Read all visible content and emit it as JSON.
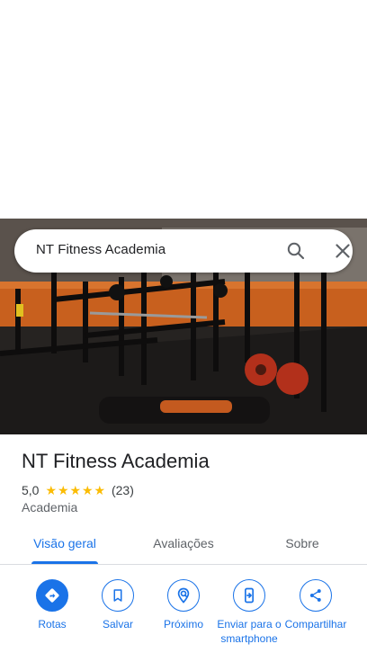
{
  "search": {
    "query": "NT Fitness Academia",
    "search_icon": "search-icon",
    "clear_icon": "close-icon"
  },
  "place": {
    "name": "NT Fitness Academia",
    "rating": "5,0",
    "stars": 5,
    "review_count": "(23)",
    "category": "Academia"
  },
  "tabs": [
    {
      "label": "Visão geral",
      "active": true
    },
    {
      "label": "Avaliações",
      "active": false
    },
    {
      "label": "Sobre",
      "active": false
    }
  ],
  "actions": [
    {
      "label": "Rotas",
      "icon": "directions-icon"
    },
    {
      "label": "Salvar",
      "icon": "bookmark-icon"
    },
    {
      "label": "Próximo",
      "icon": "nearby-icon"
    },
    {
      "label": "Enviar para o smartphone",
      "icon": "send-to-phone-icon"
    },
    {
      "label": "Compartilhar",
      "icon": "share-icon"
    }
  ],
  "colors": {
    "accent": "#1a73e8",
    "star": "#fbbc04"
  }
}
